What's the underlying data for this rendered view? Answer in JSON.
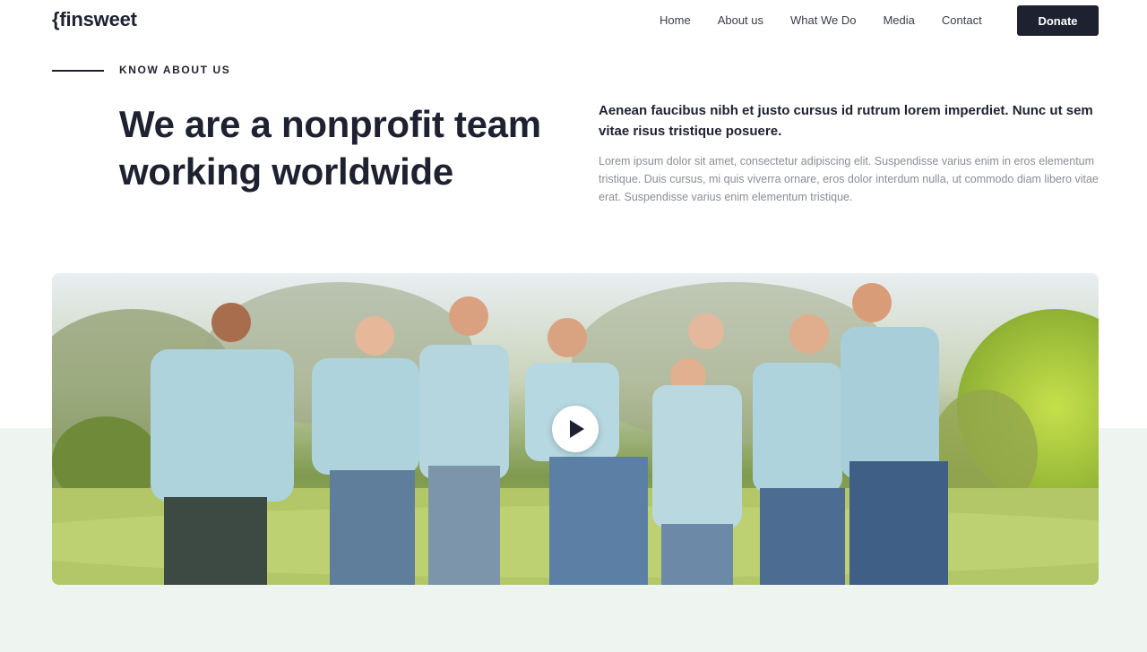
{
  "brand": {
    "logo_text": "{finsweet"
  },
  "nav": {
    "links": [
      "Home",
      "About us",
      "What We Do",
      "Media",
      "Contact"
    ],
    "donate_label": "Donate"
  },
  "section": {
    "eyebrow": "KNOW ABOUT US",
    "headline": "We are a nonprofit team working worldwide",
    "lead": "Aenean faucibus nibh et justo cursus id rutrum lorem imperdiet. Nunc ut sem vitae risus tristique posuere.",
    "body": "Lorem ipsum dolor sit amet, consectetur adipiscing elit. Suspendisse varius enim in eros elementum tristique. Duis cursus, mi quis viverra ornare, eros dolor interdum nulla, ut commodo diam libero vitae erat. Suspendisse varius enim elementum tristique."
  },
  "hero": {
    "play_icon": "play-icon"
  },
  "colors": {
    "dark": "#1e2130",
    "muted": "#8a8d97",
    "band": "#eef4f0"
  }
}
